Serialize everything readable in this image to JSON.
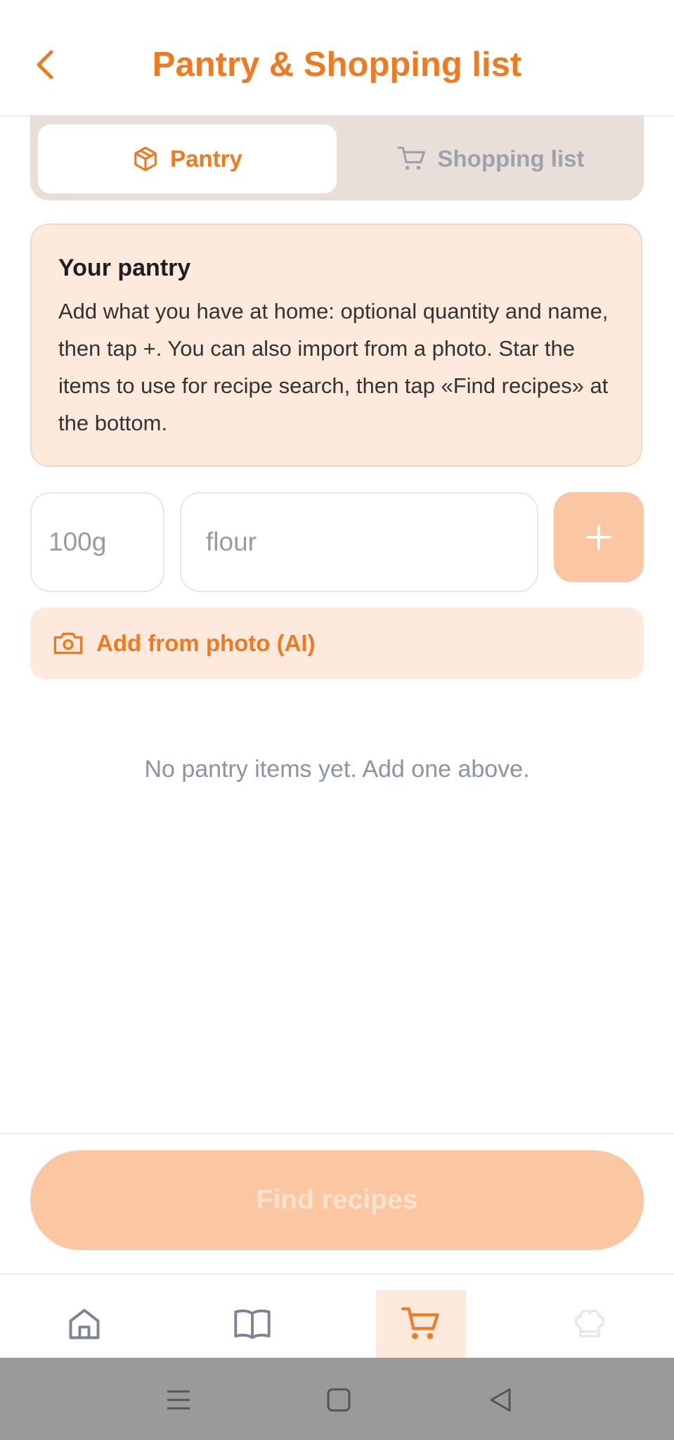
{
  "header": {
    "title": "Pantry & Shopping list",
    "back_icon": "chevron-left-icon"
  },
  "tabs": [
    {
      "label": "Pantry",
      "icon": "box-icon",
      "active": true
    },
    {
      "label": "Shopping list",
      "icon": "cart-icon",
      "active": false
    }
  ],
  "info_card": {
    "title": "Your pantry",
    "body": "Add what you have at home: optional quantity and name, then tap +. You can also import from a photo. Star the items to use for recipe search, then tap «Find recipes» at the bottom."
  },
  "add_form": {
    "quantity_placeholder": "100g",
    "name_placeholder": "flour",
    "add_icon": "plus-icon"
  },
  "photo_import": {
    "label": "Add from photo (AI)",
    "icon": "camera-icon"
  },
  "empty_state": "No pantry items yet. Add one above.",
  "find_button": "Find recipes",
  "bottom_nav": [
    {
      "icon": "home-icon",
      "active": false
    },
    {
      "icon": "book-icon",
      "active": false
    },
    {
      "icon": "cart-icon",
      "active": true
    },
    {
      "icon": "chef-hat-icon",
      "active": false
    }
  ],
  "colors": {
    "accent": "#ee7a22",
    "accent_light": "#fdeadd",
    "accent_disabled": "#fac7a2",
    "muted": "#9ca3af"
  }
}
